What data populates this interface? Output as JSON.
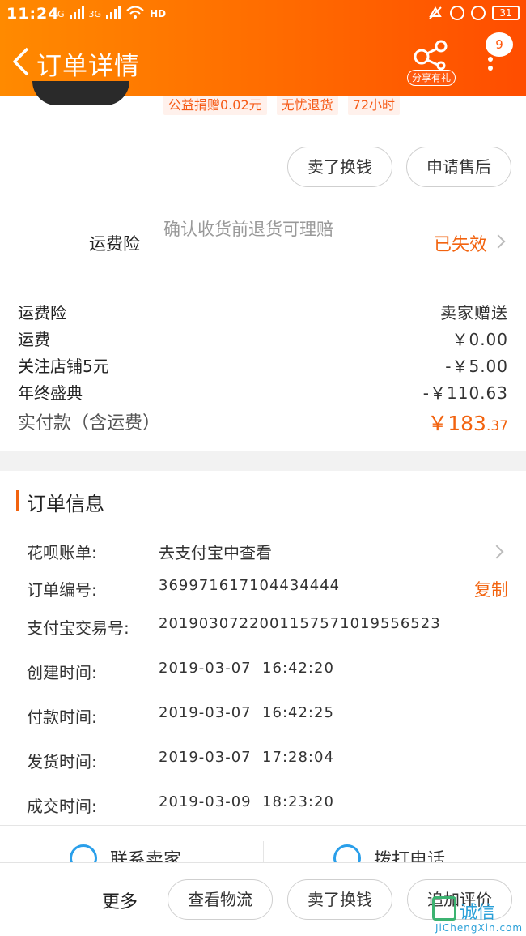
{
  "status_bar": {
    "time": "11:24",
    "net1": "4G",
    "net2": "3G",
    "hd": "HD",
    "battery": "31"
  },
  "nav": {
    "title": "订单详情",
    "share_label": "分享有礼",
    "badge_count": "9"
  },
  "tags": [
    "公益捐赠0.02元",
    "无忧退货",
    "72小时"
  ],
  "actions_top": {
    "sell_label": "卖了换钱",
    "after_sale_label": "申请售后"
  },
  "insurance": {
    "label": "运费险",
    "description": "确认收货前退货可理赔",
    "status": "已失效"
  },
  "fees": [
    {
      "label": "运费险",
      "value": "卖家赠送"
    },
    {
      "label": "运费",
      "value": "￥0.00"
    },
    {
      "label": "关注店铺5元",
      "value": "-￥5.00"
    },
    {
      "label": "年终盛典",
      "value": "-￥110.63"
    }
  ],
  "paid": {
    "label": "实付款（含运费）",
    "value_main": "￥183",
    "value_cents": ".37"
  },
  "order_info": {
    "title": "订单信息",
    "rows": [
      {
        "label": "花呗账单:",
        "value": "去支付宝中查看"
      },
      {
        "label": "订单编号:",
        "value": "369971617104434444"
      },
      {
        "label": "支付宝交易号:",
        "value": "2019030722001157571019556523"
      },
      {
        "label": "创建时间:",
        "value": "2019-03-07  16:42:20"
      },
      {
        "label": "付款时间:",
        "value": "2019-03-07  16:42:25"
      },
      {
        "label": "发货时间:",
        "value": "2019-03-07  17:28:04"
      },
      {
        "label": "成交时间:",
        "value": "2019-03-09  18:23:20"
      }
    ],
    "copy_label": "复制"
  },
  "contact": {
    "seller": "联系卖家",
    "phone": "拨打电话"
  },
  "bottom_bar": {
    "more": "更多",
    "logistics": "查看物流",
    "sell": "卖了换钱",
    "review": "追加评价"
  },
  "watermark": {
    "text": "诚信",
    "sub": "JiChengXin.com"
  },
  "colors": {
    "accent": "#f2630f",
    "header_start": "#ff8a00",
    "header_end": "#ff4d00"
  }
}
